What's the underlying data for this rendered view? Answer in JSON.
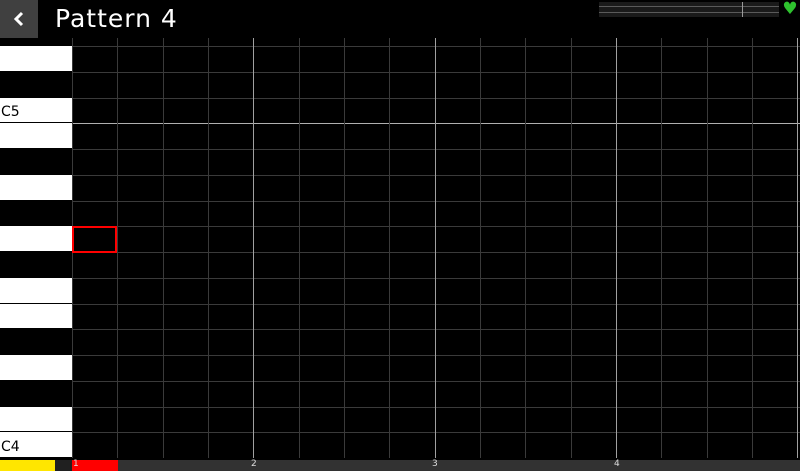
{
  "header": {
    "title": "Pattern 4",
    "back_icon": "chevron-left-icon",
    "status_icon": "heart-icon",
    "status_color": "#2ec22e"
  },
  "piano": {
    "keys": [
      {
        "color": "white",
        "label": ""
      },
      {
        "color": "black",
        "label": ""
      },
      {
        "color": "white",
        "label": "C5"
      },
      {
        "color": "white",
        "label": ""
      },
      {
        "color": "black",
        "label": ""
      },
      {
        "color": "white",
        "label": ""
      },
      {
        "color": "black",
        "label": ""
      },
      {
        "color": "white",
        "label": ""
      },
      {
        "color": "black",
        "label": ""
      },
      {
        "color": "white",
        "label": ""
      },
      {
        "color": "white",
        "label": ""
      },
      {
        "color": "black",
        "label": ""
      },
      {
        "color": "white",
        "label": ""
      },
      {
        "color": "black",
        "label": ""
      },
      {
        "color": "white",
        "label": ""
      },
      {
        "color": "white",
        "label": "C4"
      }
    ]
  },
  "timeline": {
    "bar_labels": [
      "1",
      "2",
      "3",
      "4"
    ],
    "playhead_color": "#ffe600",
    "selection_color": "#ff0000"
  },
  "cursor_color": "#ff0000"
}
